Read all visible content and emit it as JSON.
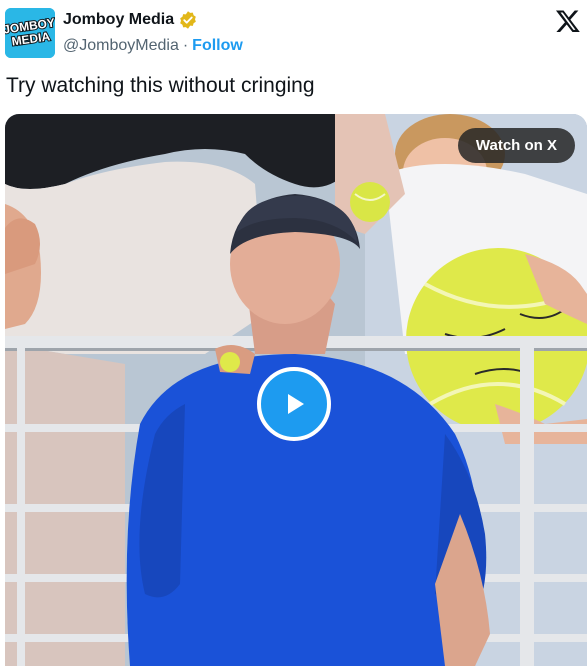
{
  "author": {
    "display_name": "Jomboy Media",
    "handle": "@JomboyMedia",
    "follow_label": "Follow",
    "avatar_text": "JOMBOY MEDIA",
    "verified_badge_color": "#e2b719"
  },
  "tweet": {
    "text": "Try watching this without cringing"
  },
  "video": {
    "watch_label": "Watch on X",
    "play_icon": "play-icon",
    "accent_color": "#1d9bf0"
  },
  "icons": {
    "platform_logo": "x-logo-icon",
    "verified": "verified-badge-icon"
  }
}
